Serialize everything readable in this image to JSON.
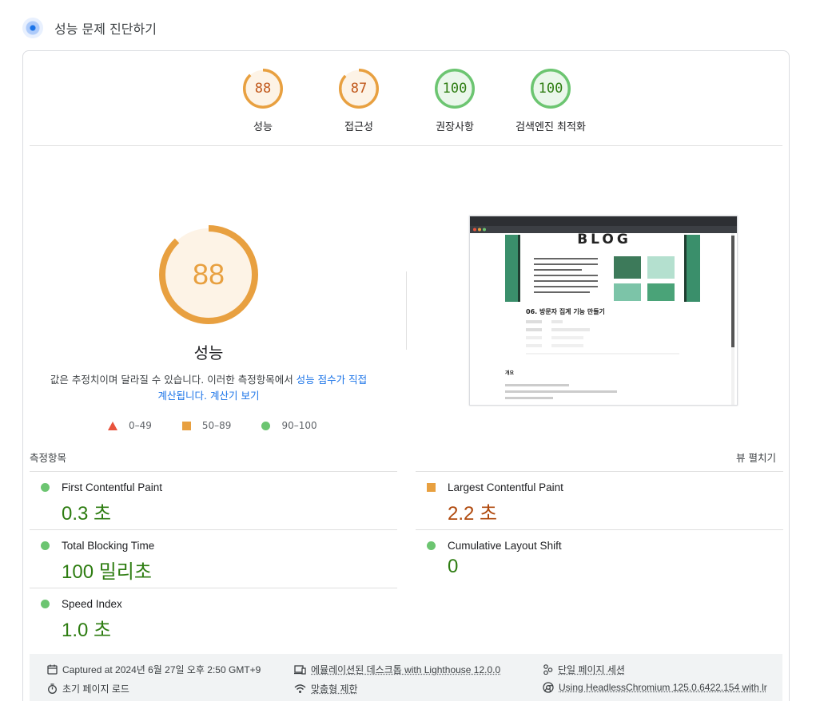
{
  "header": {
    "title": "성능 문제 진단하기"
  },
  "categories": [
    {
      "label": "성능",
      "score": "88",
      "color": "#e8a040",
      "text_color": "#c0571a",
      "fill": 0.88
    },
    {
      "label": "접근성",
      "score": "87",
      "color": "#e8a040",
      "text_color": "#c0571a",
      "fill": 0.87
    },
    {
      "label": "권장사항",
      "score": "100",
      "color": "#6cc571",
      "text_color": "#2e7d12",
      "fill": 1.0
    },
    {
      "label": "검색엔진 최적화",
      "score": "100",
      "color": "#6cc571",
      "text_color": "#2e7d12",
      "fill": 1.0
    }
  ],
  "performance": {
    "score": "88",
    "fill": 0.88,
    "title": "성능",
    "desc_text": "값은 추정치이며 달라질 수 있습니다. 이러한 측정항목에서 ",
    "desc_link1": "성능 점수가 직접 계산됩니다.",
    "desc_link2": "계산기 보기"
  },
  "legend": [
    {
      "shape": "triangle",
      "label": "0–49"
    },
    {
      "shape": "square",
      "label": "50–89"
    },
    {
      "shape": "circle",
      "label": "90–100"
    }
  ],
  "screenshot": {
    "heading": "BLOG",
    "post_title": "06. 방문자 집계 기능 만들기",
    "section": "개요"
  },
  "metrics_header": {
    "label": "측정항목",
    "expand": "뷰 펼치기"
  },
  "metrics": [
    {
      "name": "First Contentful Paint",
      "value": "0.3 초",
      "rating": "good"
    },
    {
      "name": "Largest Contentful Paint",
      "value": "2.2 초",
      "rating": "avg"
    },
    {
      "name": "Total Blocking Time",
      "value": "100 밀리초",
      "rating": "good"
    },
    {
      "name": "Cumulative Layout Shift",
      "value": "0",
      "rating": "good"
    },
    {
      "name": "Speed Index",
      "value": "1.0 초",
      "rating": "good"
    }
  ],
  "footer": {
    "captured": "Captured at 2024년 6월 27일 오후 2:50 GMT+9",
    "device": "에뮬레이션된 데스크톱 with Lighthouse 12.0.0",
    "session": "단일 페이지 세션",
    "load": "초기 페이지 로드",
    "throttle": "맞춤형 제한",
    "browser": "Using HeadlessChromium 125.0.6422.154 with lr"
  }
}
